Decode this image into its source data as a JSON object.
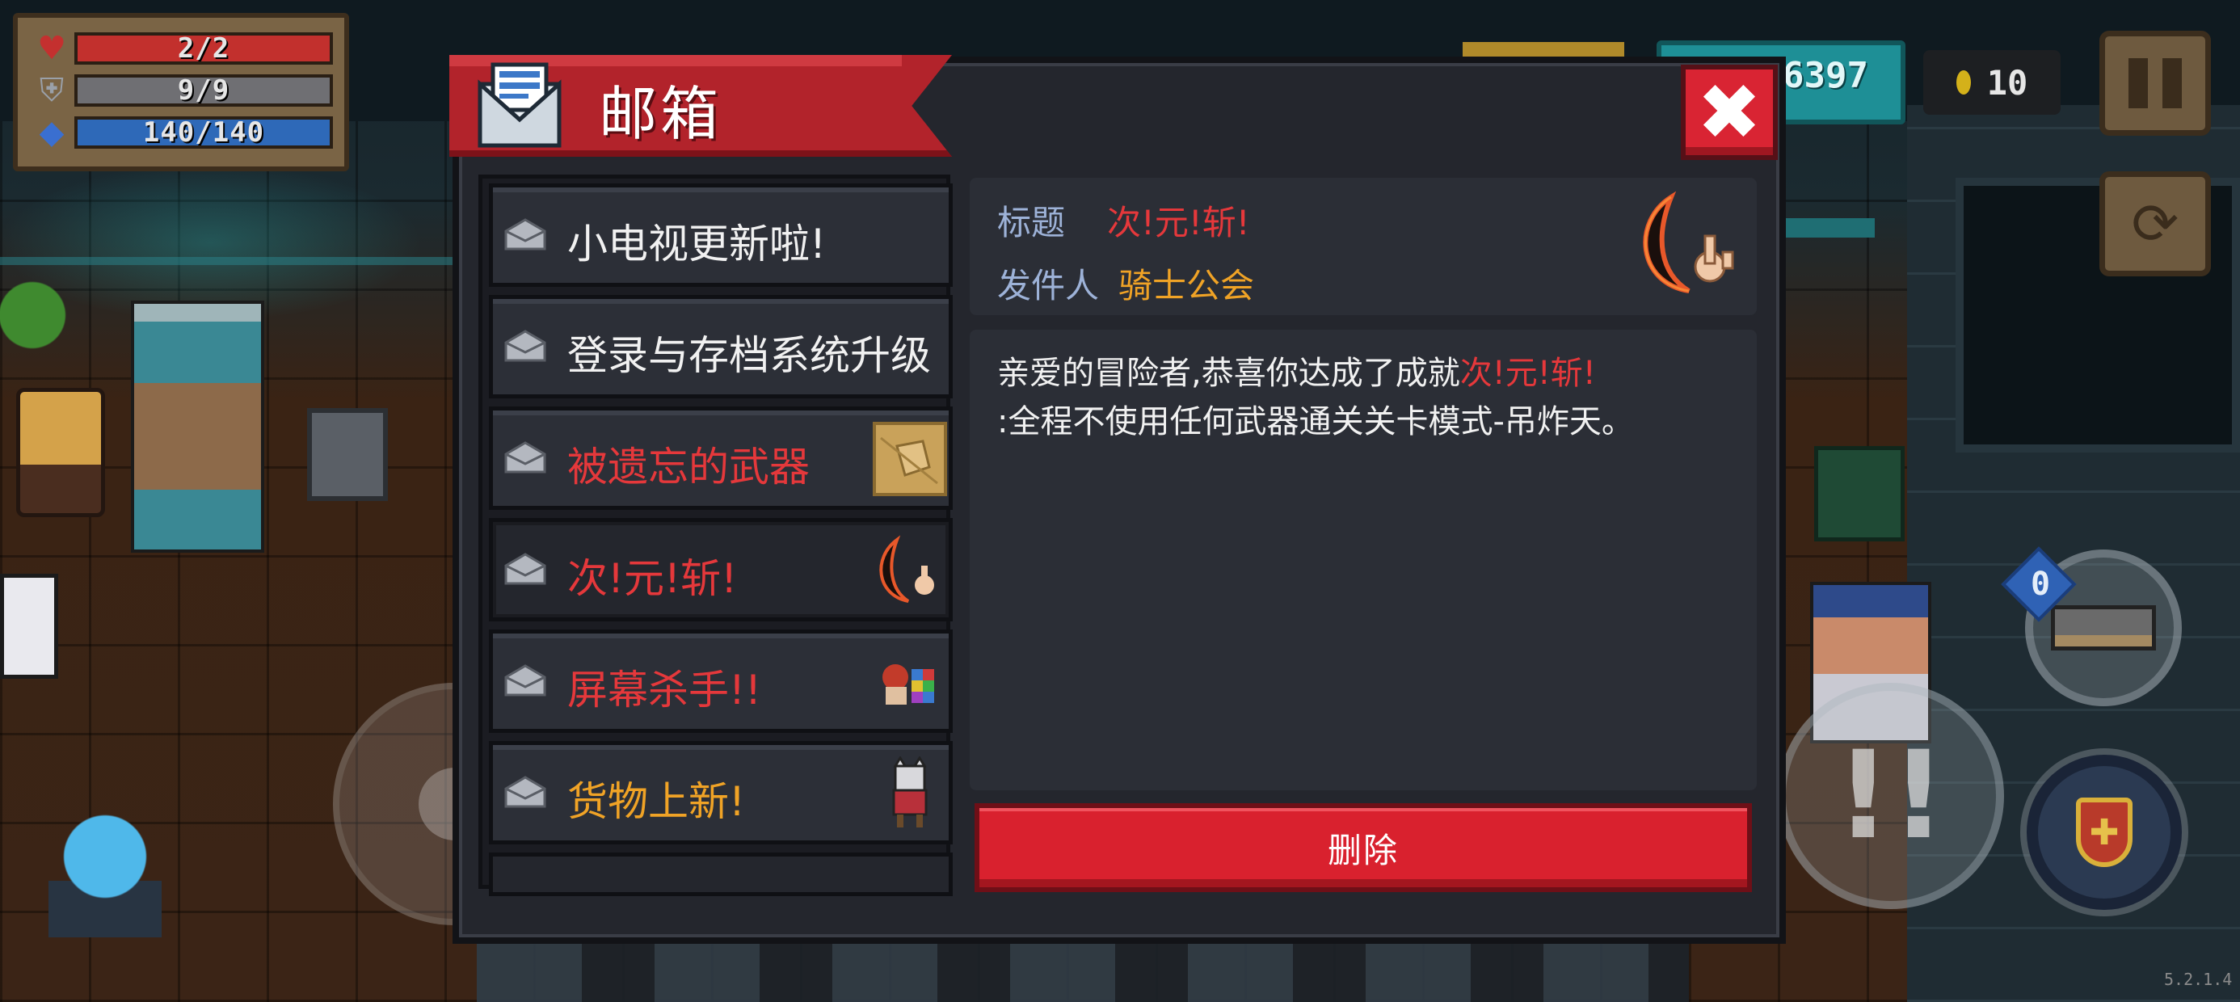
{
  "hud": {
    "hp": {
      "label": "2/2",
      "fraction": 1.0
    },
    "shield": {
      "label": "9/9",
      "fraction": 1.0
    },
    "energy": {
      "label": "140/140",
      "fraction": 1.0
    },
    "gems_partial": "6397",
    "coins": "10",
    "weapon_badge": "0",
    "version": "5.2.1.4"
  },
  "mailbox": {
    "title": "邮箱",
    "close_symbol": "✖",
    "mails": [
      {
        "subject": "小电视更新啦!",
        "color": "white",
        "thumb": "none"
      },
      {
        "subject": "登录与存档系统升级",
        "color": "white",
        "thumb": "none"
      },
      {
        "subject": "被遗忘的武器",
        "color": "red",
        "thumb": "map-scroll-icon"
      },
      {
        "subject": "次!元!斩!",
        "color": "red",
        "thumb": "crescent-blade-icon"
      },
      {
        "subject": "屏幕杀手!!",
        "color": "red",
        "thumb": "screen-killer-icon"
      },
      {
        "subject": "货物上新!",
        "color": "orange",
        "thumb": "cat-merchant-icon"
      }
    ],
    "selected_index": 3,
    "detail": {
      "title_label": "标题",
      "title_value": "次!元!斩!",
      "sender_label": "发件人",
      "sender_value": "骑士公会",
      "body_prefix": "亲爱的冒险者,恭喜你达成了成就",
      "body_highlight": "次!元!斩!",
      "body_line2": ":全程不使用任何武器通关关卡模式-吊炸天。"
    },
    "delete_label": "删除"
  },
  "colors": {
    "accent_red": "#e5383b",
    "accent_orange": "#f0a326",
    "label_blue": "#9db2d8",
    "panel_bg": "#24262d"
  }
}
